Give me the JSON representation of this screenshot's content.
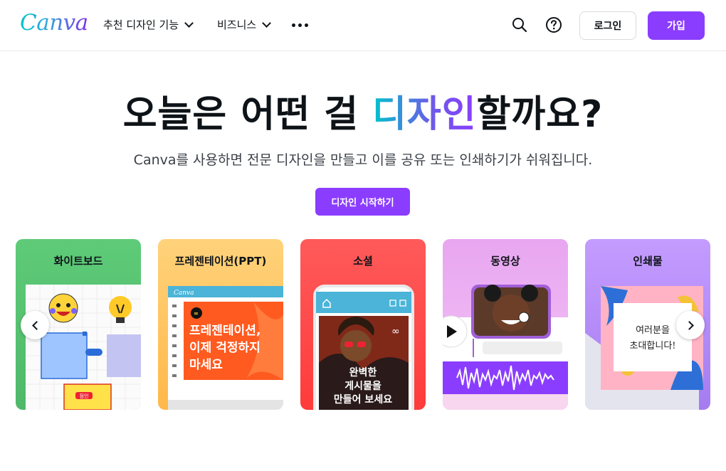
{
  "header": {
    "logo": "Canva",
    "nav": [
      {
        "label": "추천 디자인 기능"
      },
      {
        "label": "비즈니스"
      }
    ],
    "login_label": "로그인",
    "signup_label": "가입",
    "icons": [
      "search-icon",
      "help-icon",
      "more-icon"
    ]
  },
  "hero": {
    "title_before": "오늘은 어떤 걸 ",
    "title_highlight": "디자인",
    "title_after": "할까요?",
    "subtitle": "Canva를 사용하면 전문 디자인을 만들고 이를 공유 또는 인쇄하기가 쉬워집니다.",
    "cta_label": "디자인 시작하기"
  },
  "categories": [
    {
      "label": "화이트보드",
      "sticky_label": "점인"
    },
    {
      "label": "프레젠테이션(PPT)",
      "app_logo": "Canva",
      "slide_text_1": "프레젠테이션,",
      "slide_text_2": "이제 걱정하지",
      "slide_text_3": "마세요"
    },
    {
      "label": "소셜",
      "post_text_1": "완벽한",
      "post_text_2": "게시물을",
      "post_text_3": "만들어 보세요"
    },
    {
      "label": "동영상"
    },
    {
      "label": "인쇄물",
      "card_text_1": "여러분을",
      "card_text_2": "초대합니다!"
    }
  ],
  "colors": {
    "brand_purple": "#8b3dff",
    "brand_teal": "#00c4cc"
  }
}
